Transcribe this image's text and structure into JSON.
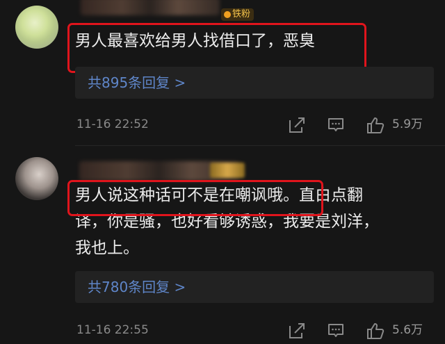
{
  "comments": [
    {
      "badge": "铁粉",
      "text": "男人最喜欢给男人找借口了，恶臭",
      "replies": "共895条回复 >",
      "time": "11-16 22:52",
      "likes": "5.9万"
    },
    {
      "text_line1": "男人说这种话可不是在嘲讽哦。直白点翻",
      "text_line2": "译，你是骚，也好看够诱惑，我要是刘洋，",
      "text_line3": "我也上。",
      "replies": "共780条回复 >",
      "time": "11-16 22:55",
      "likes": "5.6万"
    }
  ],
  "icons": [
    "share-icon",
    "comment-icon",
    "like-icon"
  ],
  "colors": {
    "highlight": "#e0141c",
    "link": "#5f86c9",
    "badge": "#f1c14a"
  }
}
